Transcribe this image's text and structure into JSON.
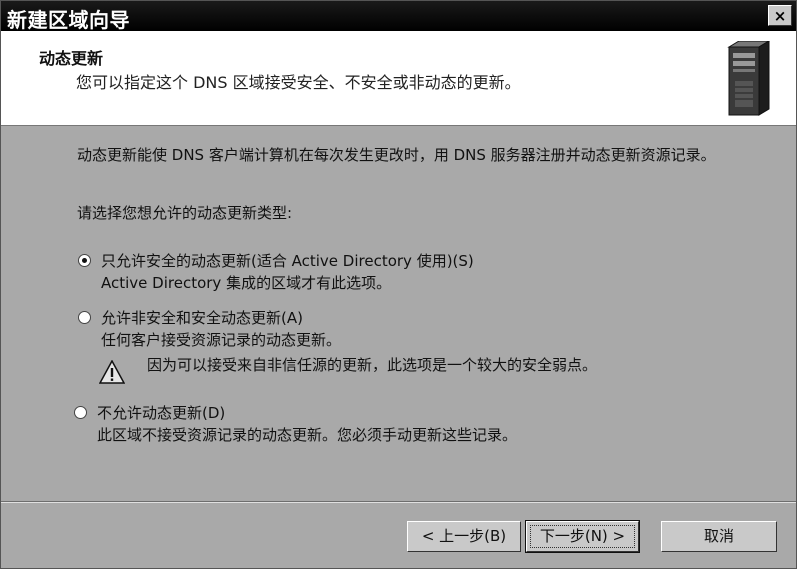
{
  "window": {
    "title": "新建区域向导",
    "close_label": "×"
  },
  "header": {
    "title": "动态更新",
    "subtitle": "您可以指定这个 DNS 区域接受安全、不安全或非动态的更新。",
    "icon": "server-tower-icon"
  },
  "content": {
    "description": "动态更新能使 DNS 客户端计算机在每次发生更改时，用 DNS 服务器注册并动态更新资源记录。",
    "prompt": "请选择您想允许的动态更新类型:",
    "options": [
      {
        "label": "只允许安全的动态更新(适合 Active Directory 使用)(S)",
        "note": "Active Directory 集成的区域才有此选项。",
        "selected": true
      },
      {
        "label": "允许非安全和安全动态更新(A)",
        "note": "任何客户接受资源记录的动态更新。",
        "warning": "因为可以接受来自非信任源的更新，此选项是一个较大的安全弱点。",
        "selected": false
      },
      {
        "label": "不允许动态更新(D)",
        "note": "此区域不接受资源记录的动态更新。您必须手动更新这些记录。",
        "selected": false
      }
    ]
  },
  "buttons": {
    "back": "< 上一步(B)",
    "next": "下一步(N) >",
    "cancel": "取消"
  }
}
